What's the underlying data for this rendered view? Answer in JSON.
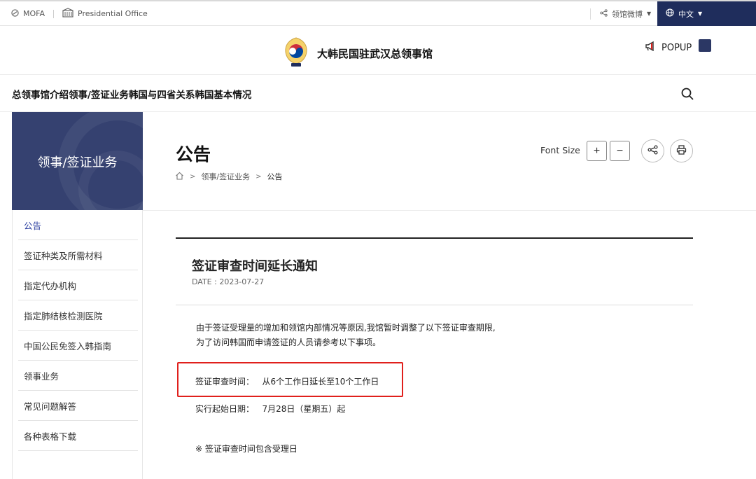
{
  "topbar": {
    "mofa_label": "MOFA",
    "presidential_label": "Presidential Office",
    "weibo_label": "领馆微博",
    "lang_label": "中文"
  },
  "header": {
    "site_title": "大韩民国驻武汉总领事馆",
    "popup_label": "POPUP"
  },
  "nav": {
    "items": [
      "总领事馆介绍",
      "领事/签证业务",
      "韩国与四省关系",
      "韩国基本情况"
    ]
  },
  "sidebar": {
    "banner_title": "领事/签证业务",
    "items": [
      {
        "label": "公告",
        "active": true
      },
      {
        "label": "签证种类及所需材料",
        "active": false
      },
      {
        "label": "指定代办机构",
        "active": false
      },
      {
        "label": "指定肺结核检测医院",
        "active": false
      },
      {
        "label": "中国公民免签入韩指南",
        "active": false
      },
      {
        "label": "领事业务",
        "active": false
      },
      {
        "label": "常见问题解答",
        "active": false
      },
      {
        "label": "各种表格下载",
        "active": false
      }
    ]
  },
  "content": {
    "page_title": "公告",
    "breadcrumb": [
      "领事/签证业务",
      "公告"
    ],
    "font_size_label": "Font Size",
    "font_plus": "+",
    "font_minus": "−"
  },
  "article": {
    "title": "签证审查时间延长通知",
    "date": "DATE : 2023-07-27",
    "paragraph_line1": "由于签证受理量的增加和领馆内部情况等原因,我馆暂时调整了以下签证审查期限,",
    "paragraph_line2": "为了访问韩国而申请签证的人员请参考以下事项。",
    "row1_label": "签证审查时间：",
    "row1_value": "从6个工作日延长至10个工作日",
    "row2_label": "实行起始日期：",
    "row2_value": "7月28日（星期五）起",
    "note": "※ 签证审查时间包含受理日"
  },
  "colors": {
    "navy": "#1f2d5c",
    "banner": "#354170",
    "highlight": "#e0201c",
    "active_link": "#2b3fa0"
  },
  "icons": [
    "mofa-icon",
    "presidential-office-icon",
    "share-icon",
    "globe-icon",
    "megaphone-icon",
    "search-icon",
    "home-icon",
    "print-icon"
  ]
}
